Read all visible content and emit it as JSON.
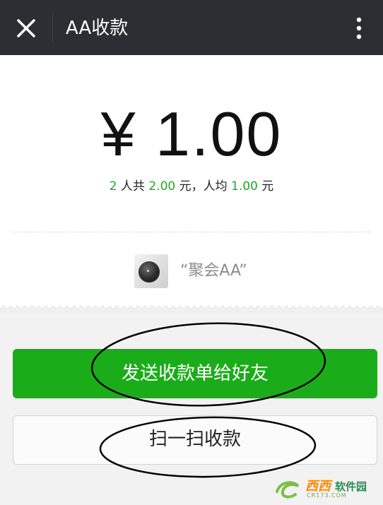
{
  "header": {
    "title": "AA收款",
    "close_icon": "close-icon",
    "menu_icon": "more-vertical-icon"
  },
  "amount": {
    "display": "¥ 1.00"
  },
  "summary": {
    "people": "2",
    "part1": " 人共 ",
    "total": "2.00",
    "part2": " 元，人均 ",
    "per_person": "1.00",
    "part3": " 元"
  },
  "group": {
    "name": "“聚会AA”",
    "avatar_icon": "group-avatar"
  },
  "actions": {
    "send_label": "发送收款单给好友",
    "scan_label": "扫一扫收款"
  },
  "watermark": {
    "brand_a": "西西",
    "brand_b": "软件园",
    "domain": "CR173.COM"
  },
  "colors": {
    "accent_green": "#1aad19",
    "header_bg": "#2b2f33",
    "panel_bg": "#f2f2f2"
  }
}
